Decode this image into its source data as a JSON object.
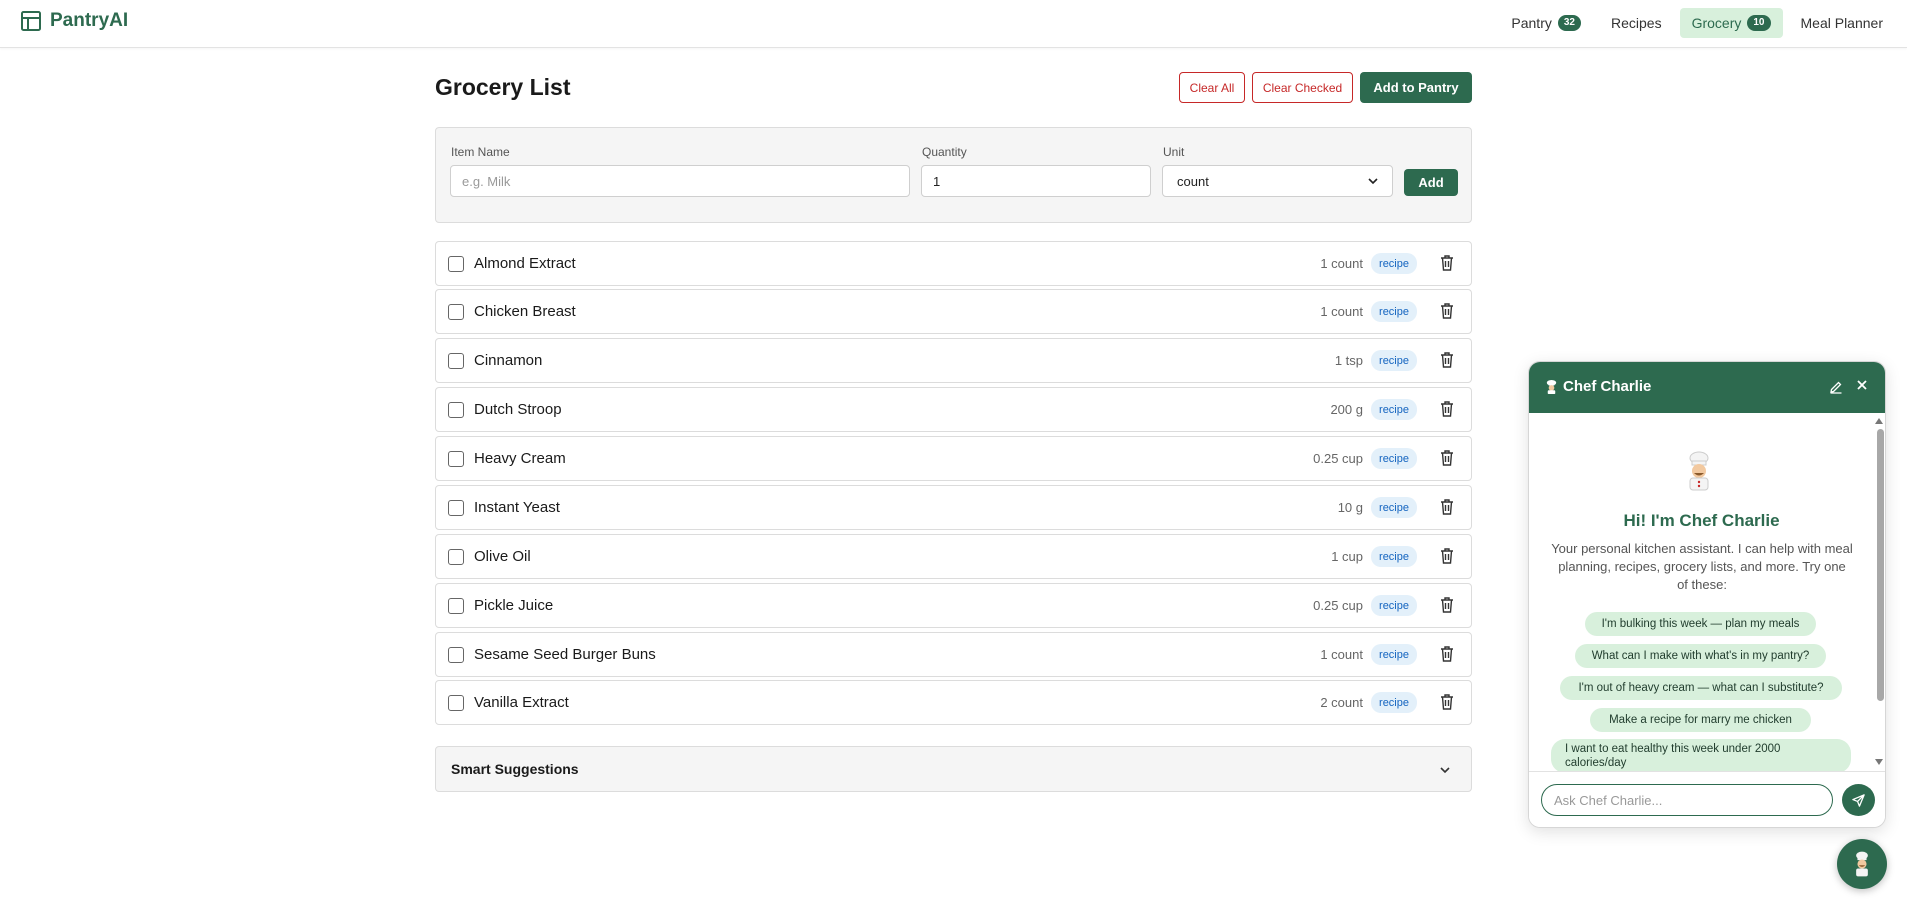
{
  "app": {
    "name": "PantryAI"
  },
  "nav": {
    "items": [
      {
        "label": "Pantry",
        "badge": "32",
        "active": false
      },
      {
        "label": "Recipes",
        "badge": null,
        "active": false
      },
      {
        "label": "Grocery",
        "badge": "10",
        "active": true
      },
      {
        "label": "Meal Planner",
        "badge": null,
        "active": false
      }
    ]
  },
  "page": {
    "title": "Grocery List",
    "clear_all_label": "Clear All",
    "clear_checked_label": "Clear Checked",
    "add_to_pantry_label": "Add to Pantry"
  },
  "form": {
    "item_name_label": "Item Name",
    "item_name_placeholder": "e.g. Milk",
    "item_name_value": "",
    "quantity_label": "Quantity",
    "quantity_value": "1",
    "unit_label": "Unit",
    "unit_value": "count",
    "add_label": "Add"
  },
  "items": [
    {
      "name": "Almond Extract",
      "qty": "1 count",
      "tag": "recipe",
      "checked": false
    },
    {
      "name": "Chicken Breast",
      "qty": "1 count",
      "tag": "recipe",
      "checked": false
    },
    {
      "name": "Cinnamon",
      "qty": "1 tsp",
      "tag": "recipe",
      "checked": false
    },
    {
      "name": "Dutch Stroop",
      "qty": "200 g",
      "tag": "recipe",
      "checked": false
    },
    {
      "name": "Heavy Cream",
      "qty": "0.25 cup",
      "tag": "recipe",
      "checked": false
    },
    {
      "name": "Instant Yeast",
      "qty": "10 g",
      "tag": "recipe",
      "checked": false
    },
    {
      "name": "Olive Oil",
      "qty": "1 cup",
      "tag": "recipe",
      "checked": false
    },
    {
      "name": "Pickle Juice",
      "qty": "0.25 cup",
      "tag": "recipe",
      "checked": false
    },
    {
      "name": "Sesame Seed Burger Buns",
      "qty": "1 count",
      "tag": "recipe",
      "checked": false
    },
    {
      "name": "Vanilla Extract",
      "qty": "2 count",
      "tag": "recipe",
      "checked": false
    }
  ],
  "suggestions": {
    "title": "Smart Suggestions"
  },
  "chat": {
    "title": "Chef Charlie",
    "greeting": "Hi! I'm Chef Charlie",
    "intro": "Your personal kitchen assistant. I can help with meal planning, recipes, grocery lists, and more. Try one of these:",
    "prompts": [
      "I'm bulking this week — plan my meals",
      "What can I make with what's in my pantry?",
      "I'm out of heavy cream — what can I substitute?",
      "Make a recipe for marry me chicken",
      "I want to eat healthy this week under 2000 calories/day"
    ],
    "input_placeholder": "Ask Chef Charlie...",
    "input_value": ""
  },
  "colors": {
    "brand_green": "#2d6a4f",
    "active_nav_bg": "#d8f0dc",
    "danger_red": "#c62828",
    "tag_blue": "#1565c0",
    "tag_bg": "#e3f0fa"
  },
  "icons": {
    "brand": "layout-icon",
    "trash": "trash-icon",
    "chevron": "chevron-down-icon",
    "edit": "pencil-icon",
    "close": "close-icon",
    "send": "send-icon",
    "chef": "chef-icon"
  }
}
